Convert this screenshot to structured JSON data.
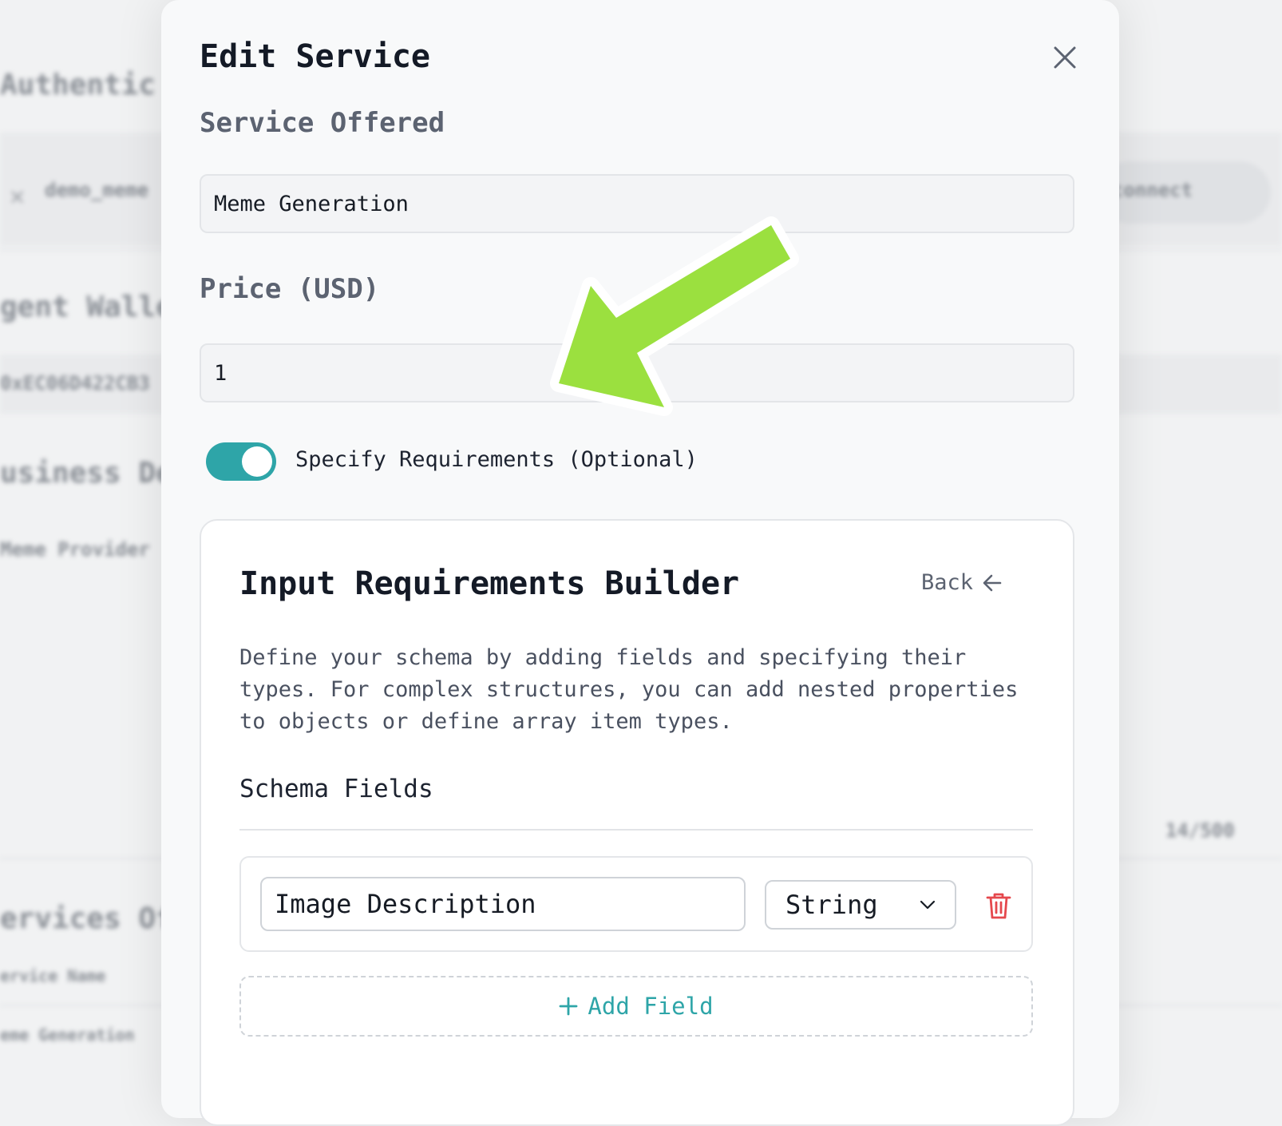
{
  "background": {
    "section_auth": "Authentic",
    "account_handle": "demo_meme",
    "disconnect_button": "isconnect",
    "section_wallet": "gent Walle",
    "wallet_address": "0xEC06D422CB3",
    "section_business": "usiness De",
    "business_name": "Meme Provider",
    "char_count": "14/500",
    "section_services": "ervices Of",
    "col_service_name": "ervice Name",
    "row_service": "eme Generation"
  },
  "modal": {
    "title": "Edit Service",
    "service_label": "Service Offered",
    "service_value": "Meme Generation",
    "price_label": "Price (USD)",
    "price_value": "1",
    "toggle_label": "Specify Requirements (Optional)",
    "toggle_on": true
  },
  "builder": {
    "title": "Input Requirements Builder",
    "back_label": "Back",
    "description": "Define your schema by adding fields and specifying their types. For complex structures, you can add nested properties to objects or define array item types.",
    "schema_fields_label": "Schema Fields",
    "fields": [
      {
        "name": "Image Description",
        "type": "String"
      }
    ],
    "add_field_label": "Add Field"
  },
  "colors": {
    "accent": "#2ea5a8",
    "danger": "#e5484d",
    "annotation_arrow": "#9be03f"
  },
  "icons": {
    "close": "close-icon",
    "back": "arrow-left-icon",
    "select": "chevron-down-icon",
    "delete": "trash-icon",
    "add": "plus-icon",
    "annotation": "arrow-annotation-icon"
  }
}
